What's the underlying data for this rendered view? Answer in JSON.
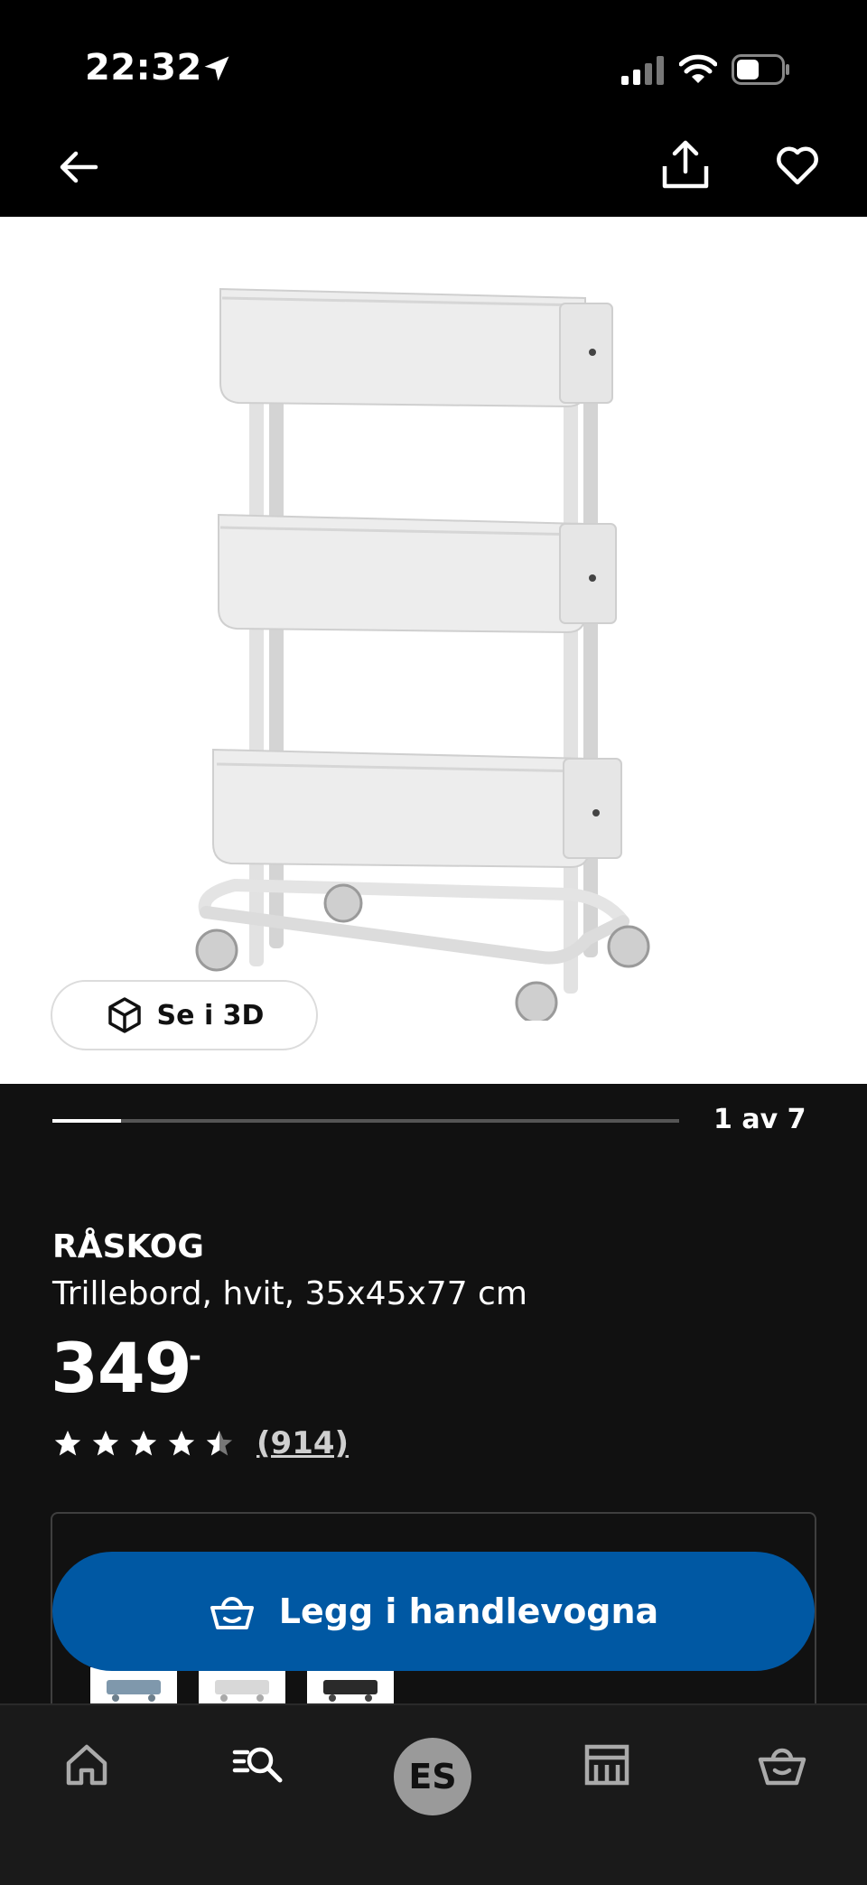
{
  "status_bar": {
    "time": "22:32"
  },
  "top_nav": {
    "back_icon": "arrow-left-icon",
    "share_icon": "share-icon",
    "favorite_icon": "heart-icon"
  },
  "gallery": {
    "view_3d_label": "Se i 3D",
    "position_label": "1 av 7",
    "progress": 0.11
  },
  "product": {
    "name": "RÅSKOG",
    "description": "Trillebord, hvit, 35x45x77 cm",
    "price": "349",
    "price_suffix": ",-",
    "rating": 4.5,
    "review_count": "(914)"
  },
  "actions": {
    "add_to_cart_label": "Legg i handlevogna"
  },
  "bottom_nav": {
    "items": [
      "home-icon",
      "search-icon",
      "profile-avatar",
      "store-icon",
      "basket-icon"
    ],
    "avatar_initials": "ES"
  },
  "colors": {
    "background": "#111111",
    "accent_blue": "#0058a3",
    "surface_white": "#ffffff"
  }
}
